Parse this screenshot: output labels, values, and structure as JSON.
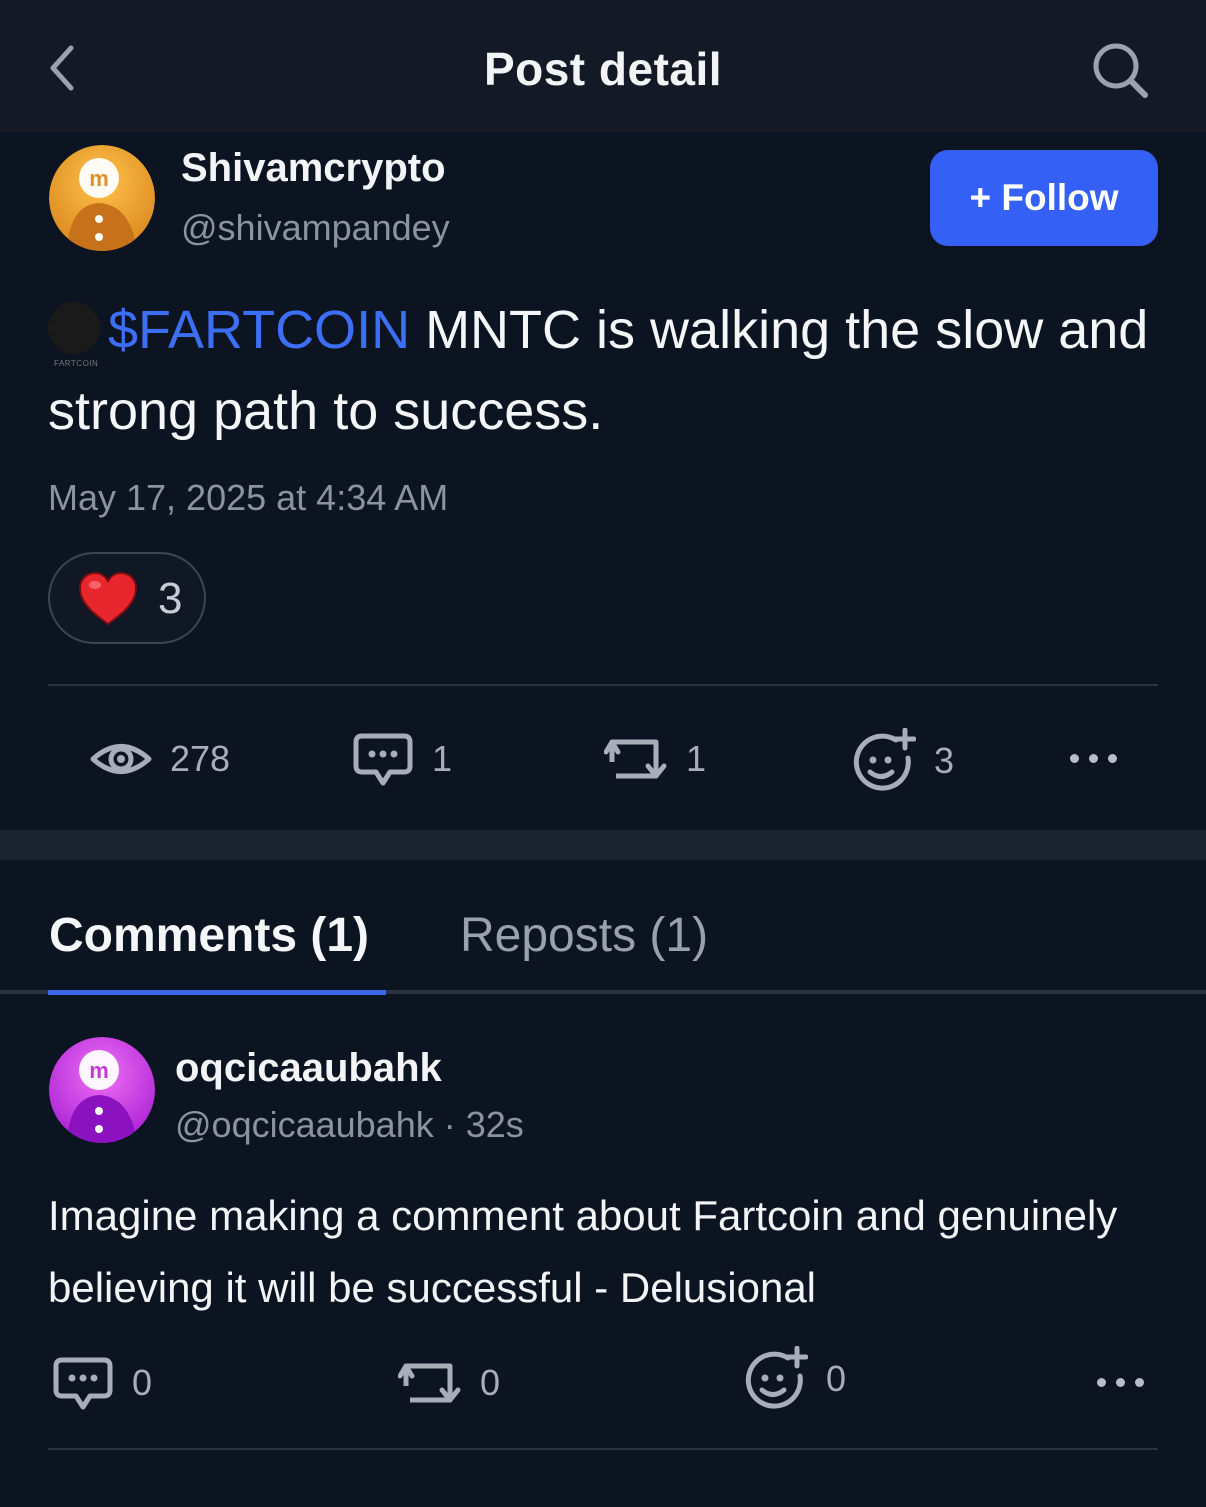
{
  "header": {
    "title": "Post detail"
  },
  "post": {
    "author": {
      "name": "Shivamcrypto",
      "handle": "@shivampandey"
    },
    "follow_label": "+ Follow",
    "coin_icon_text": "FARTCOIN",
    "ticker": "$FARTCOIN",
    "body": "MNTC is walking the slow and strong path to success.",
    "timestamp": "May 17, 2025 at 4:34 AM",
    "reaction": {
      "emoji": "heart",
      "count": "3"
    },
    "stats": {
      "views": "278",
      "comments": "1",
      "reposts": "1",
      "reactions": "3"
    }
  },
  "tabs": {
    "comments": "Comments (1)",
    "reposts": "Reposts (1)"
  },
  "comment": {
    "author": "oqcicaaubahk",
    "meta": "@oqcicaaubahk · 32s",
    "text": "Imagine making a comment about Fartcoin and genuinely believing it will be successful - Delusional",
    "stats": {
      "comments": "0",
      "reposts": "0",
      "reactions": "0"
    }
  },
  "colors": {
    "background": "#0c1321",
    "header": "#141a25",
    "accent": "#3460f5",
    "ticker": "#3c6ff5",
    "muted": "#8b93a3",
    "heart": "#e8262d",
    "author_avatar": "#f0a32c",
    "commenter_avatar": "#c531e0"
  },
  "icons": [
    "chevron-left-icon",
    "search-icon",
    "eye-icon",
    "comment-icon",
    "repost-icon",
    "add-reaction-icon",
    "more-icon",
    "heart-icon"
  ]
}
